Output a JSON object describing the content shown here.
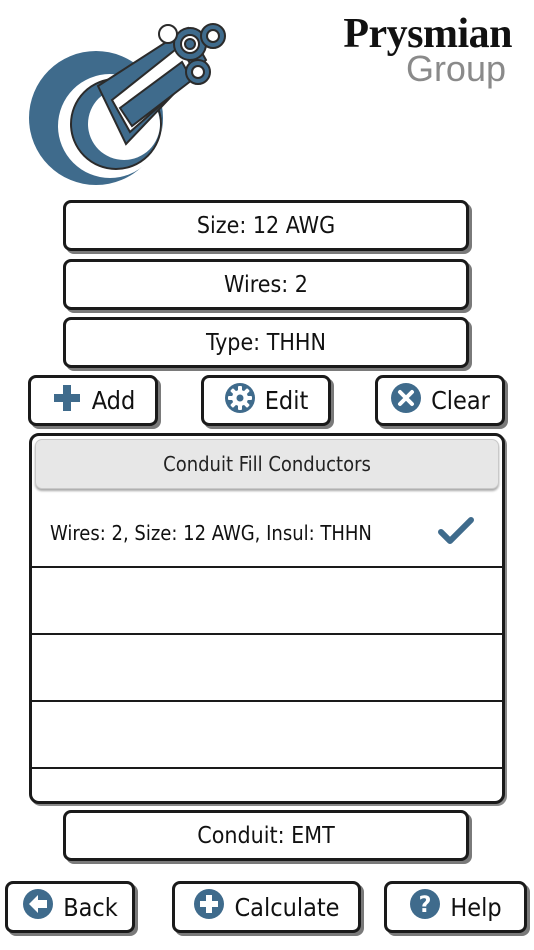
{
  "brand": {
    "name": "Prysmian",
    "group": "Group",
    "logo_icon": "cable-logo-icon",
    "accent": "#3f6b8c"
  },
  "selectors": {
    "size": "Size: 12 AWG",
    "wires": "Wires: 2",
    "type": "Type: THHN"
  },
  "actions": {
    "add": {
      "label": "Add",
      "icon": "plus-icon"
    },
    "edit": {
      "label": "Edit",
      "icon": "gear-icon"
    },
    "clear": {
      "label": "Clear",
      "icon": "x-circle-icon"
    }
  },
  "conductors": {
    "header": "Conduit Fill Conductors",
    "rows": [
      {
        "text": "Wires: 2, Size: 12 AWG, Insul: THHN",
        "checked": true
      },
      {
        "text": "",
        "checked": false
      },
      {
        "text": "",
        "checked": false
      },
      {
        "text": "",
        "checked": false
      }
    ]
  },
  "conduit": "Conduit: EMT",
  "bottom": {
    "back": {
      "label": "Back",
      "icon": "back-arrow-icon"
    },
    "calculate": {
      "label": "Calculate",
      "icon": "plus-circle-icon"
    },
    "help": {
      "label": "Help",
      "icon": "question-icon"
    }
  }
}
